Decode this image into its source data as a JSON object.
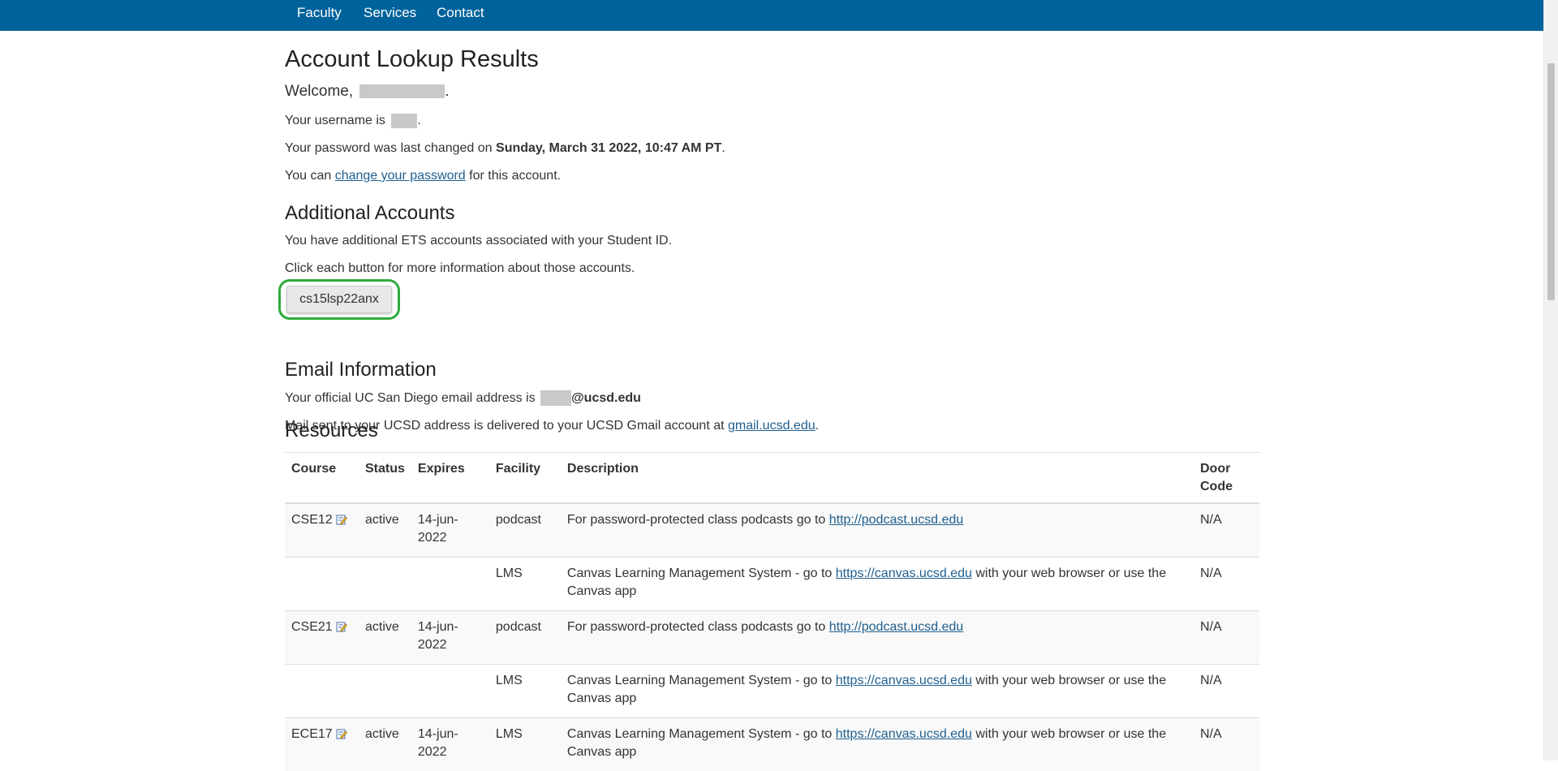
{
  "nav": {
    "items": [
      "Faculty",
      "Services",
      "Contact"
    ],
    "background": "#00629b"
  },
  "page": {
    "title": "Account Lookup Results",
    "welcome_prefix": "Welcome,",
    "welcome_suffix": ".",
    "username_prefix": "Your username is",
    "username_suffix": ".",
    "password_prefix": "Your password was last changed on",
    "password_date": "Sunday, March 31 2022, 10:47 AM PT",
    "password_suffix": ".",
    "change_prefix": "You can",
    "change_link": "change your password",
    "change_suffix": "for this account."
  },
  "additional": {
    "heading": "Additional Accounts",
    "line1": "You have additional ETS accounts associated with your Student ID.",
    "line2": "Click each button for more information about those accounts.",
    "button_label": "cs15lsp22anx",
    "highlight_color": "#2eaa3c"
  },
  "email": {
    "heading": "Email Information",
    "line1_prefix": "Your official UC San Diego email address is",
    "domain": "@ucsd.edu",
    "line2_prefix": "Mail sent to your UCSD address is delivered to your UCSD Gmail account at",
    "gmail_link": "gmail.ucsd.edu",
    "line2_suffix": "."
  },
  "resources": {
    "heading": "Resources",
    "columns": [
      "Course",
      "Status",
      "Expires",
      "Facility",
      "Description",
      "Door Code"
    ],
    "rows": [
      {
        "course": "CSE12",
        "status": "active",
        "expires": "14-jun-2022",
        "facility": "podcast",
        "desc_prefix": "For password-protected class podcasts go to",
        "link": "http://podcast.ucsd.edu",
        "desc_suffix": "",
        "door": "N/A"
      },
      {
        "course": "",
        "status": "",
        "expires": "",
        "facility": "LMS",
        "desc_prefix": "Canvas Learning Management System - go to",
        "link": "https://canvas.ucsd.edu",
        "desc_suffix": "with your web browser or use the Canvas app",
        "door": "N/A"
      },
      {
        "course": "CSE21",
        "status": "active",
        "expires": "14-jun-2022",
        "facility": "podcast",
        "desc_prefix": "For password-protected class podcasts go to",
        "link": "http://podcast.ucsd.edu",
        "desc_suffix": "",
        "door": "N/A"
      },
      {
        "course": "",
        "status": "",
        "expires": "",
        "facility": "LMS",
        "desc_prefix": "Canvas Learning Management System - go to",
        "link": "https://canvas.ucsd.edu",
        "desc_suffix": "with your web browser or use the Canvas app",
        "door": "N/A"
      },
      {
        "course": "ECE17",
        "status": "active",
        "expires": "14-jun-2022",
        "facility": "LMS",
        "desc_prefix": "Canvas Learning Management System - go to",
        "link": "https://canvas.ucsd.edu",
        "desc_suffix": "with your web browser or use the Canvas app",
        "door": "N/A"
      }
    ],
    "course_icon": "edit-note-icon"
  }
}
